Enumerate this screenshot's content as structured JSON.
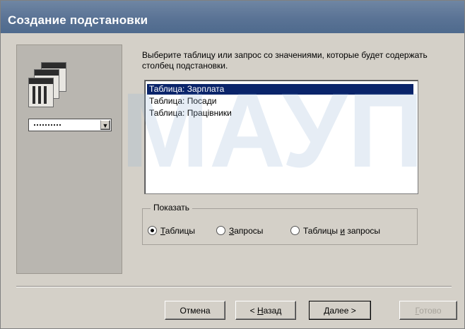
{
  "window": {
    "title": "Создание подстановки"
  },
  "left_panel": {
    "icon_primary": "table-stack-icon",
    "icon_secondary": "combo-box-preview-icon",
    "combo_icon": "chevron-down-icon"
  },
  "content": {
    "instruction": "Выберите таблицу или запрос со значениями, которые будет содержать столбец подстановки."
  },
  "list": {
    "items": [
      {
        "label": "Таблица: Зарплата",
        "selected": true
      },
      {
        "label": "Таблица: Посади",
        "selected": false
      },
      {
        "label": "Таблица: Працівники",
        "selected": false
      }
    ]
  },
  "show_group": {
    "label": "Показать",
    "options": [
      {
        "label_prefix": "",
        "label_hot": "Т",
        "label_rest": "аблицы",
        "selected": true
      },
      {
        "label_prefix": "",
        "label_hot": "З",
        "label_rest": "апросы",
        "selected": false
      },
      {
        "label_prefix": "Таблицы ",
        "label_hot": "и",
        "label_rest": " запросы",
        "selected": false
      }
    ]
  },
  "buttons": {
    "cancel": "Отмена",
    "back_prefix": "< ",
    "back_hot": "Н",
    "back_rest": "азад",
    "next_prefix": "",
    "next_hot": "Д",
    "next_rest": "алее >",
    "finish_prefix": "",
    "finish_hot": "Г",
    "finish_rest": "отово"
  },
  "watermark": {
    "text": "МАУП"
  },
  "colors": {
    "title_bar": "#5a7395",
    "selection": "#0a246a",
    "dialog_bg": "#d4d0c8",
    "left_panel_bg": "#b9b6b0"
  }
}
